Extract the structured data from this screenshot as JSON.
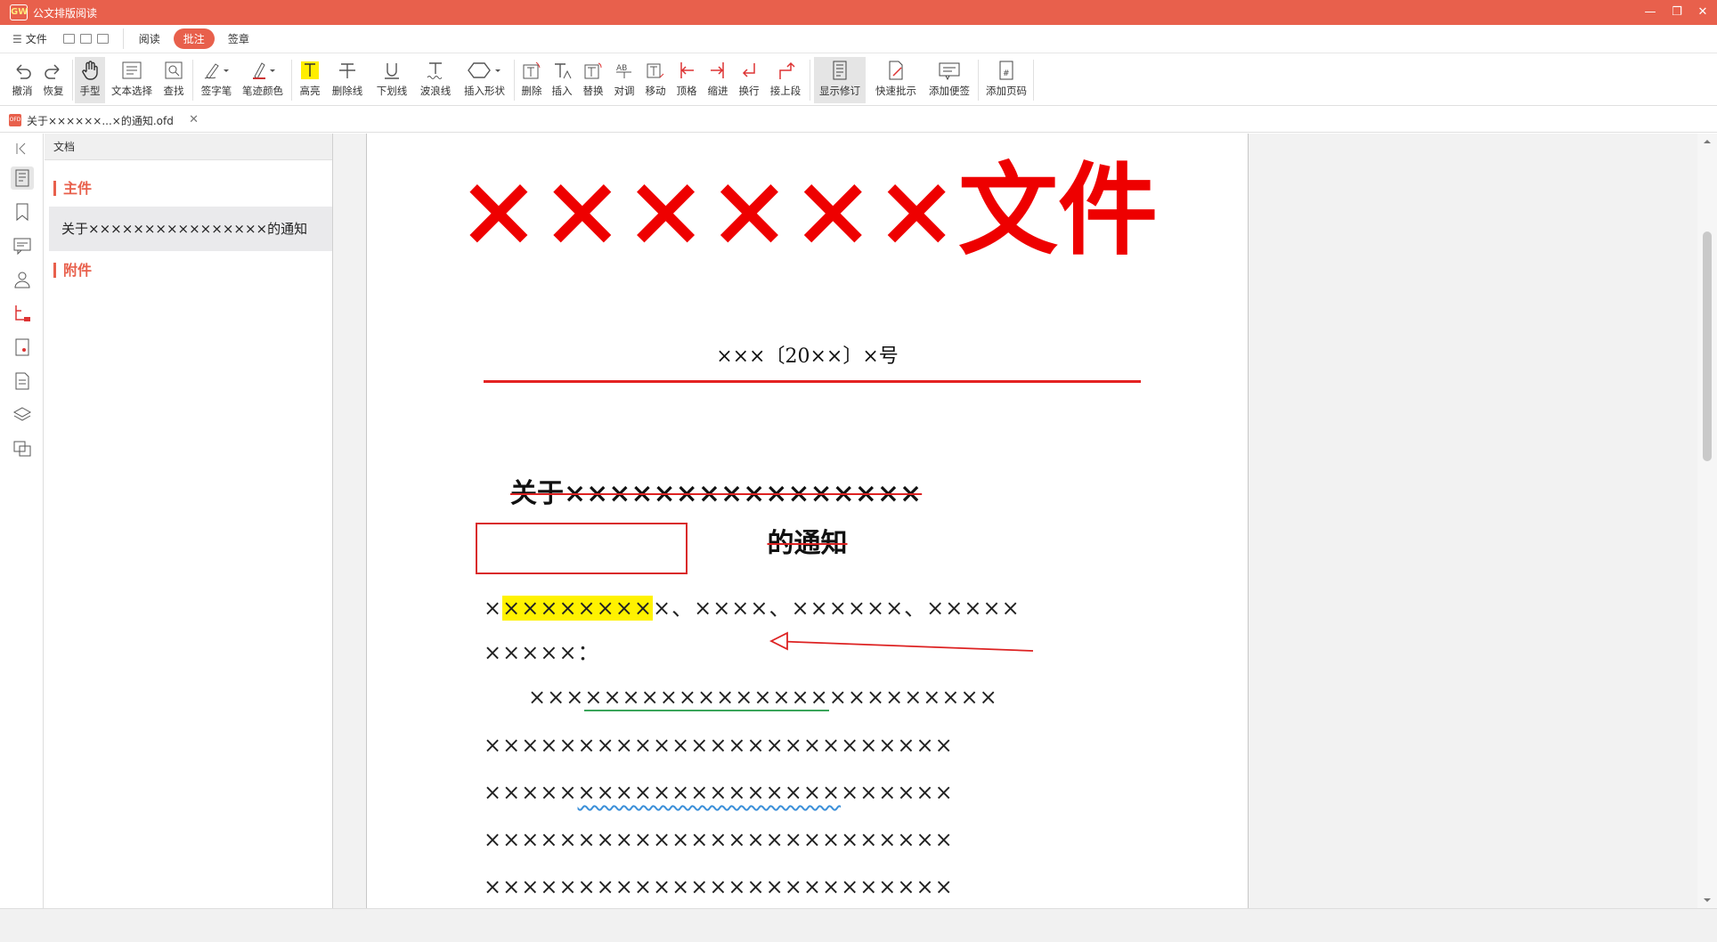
{
  "window": {
    "title": "公文排版阅读",
    "logo": "GW",
    "controls": [
      "—",
      "❐",
      "✕"
    ]
  },
  "menubar": {
    "file_label": "文件",
    "tabs": [
      {
        "label": "阅读",
        "active": false
      },
      {
        "label": "批注",
        "active": true
      },
      {
        "label": "签章",
        "active": false
      }
    ]
  },
  "toolbar": {
    "items": [
      {
        "label": "撤消",
        "icon": "undo-icon"
      },
      {
        "label": "恢复",
        "icon": "redo-icon"
      },
      {
        "label": "手型",
        "icon": "hand-icon",
        "selected": true
      },
      {
        "label": "文本选择",
        "icon": "text-select-icon"
      },
      {
        "label": "查找",
        "icon": "find-icon"
      },
      {
        "label": "签字笔",
        "icon": "pen-icon"
      },
      {
        "label": "笔迹颜色",
        "icon": "pen-color-icon"
      },
      {
        "label": "高亮",
        "icon": "highlight-icon"
      },
      {
        "label": "删除线",
        "icon": "strikethrough-icon"
      },
      {
        "label": "下划线",
        "icon": "underline-icon"
      },
      {
        "label": "波浪线",
        "icon": "wavy-line-icon"
      },
      {
        "label": "插入形状",
        "icon": "shape-icon"
      },
      {
        "label": "删除",
        "icon": "delete-mark-icon"
      },
      {
        "label": "插入",
        "icon": "insert-mark-icon"
      },
      {
        "label": "替换",
        "icon": "replace-mark-icon"
      },
      {
        "label": "对调",
        "icon": "swap-mark-icon"
      },
      {
        "label": "移动",
        "icon": "move-mark-icon"
      },
      {
        "label": "顶格",
        "icon": "align-left-mark-icon"
      },
      {
        "label": "缩进",
        "icon": "indent-mark-icon"
      },
      {
        "label": "换行",
        "icon": "newline-mark-icon"
      },
      {
        "label": "接上段",
        "icon": "join-paragraph-icon"
      },
      {
        "label": "显示修订",
        "icon": "show-revisions-icon",
        "selected": true
      },
      {
        "label": "快速批示",
        "icon": "quick-comment-icon"
      },
      {
        "label": "添加便签",
        "icon": "sticky-note-icon"
      },
      {
        "label": "添加页码",
        "icon": "page-number-icon"
      }
    ]
  },
  "doc_tab": {
    "file_badge": "OFD",
    "label": "关于××××××...×的通知.ofd",
    "close": "✕"
  },
  "left_strip": {
    "icons": [
      "collapse-icon",
      "outline-icon",
      "bookmark-icon",
      "comment-icon",
      "user-icon",
      "annotation-tree-icon",
      "page-thumbnail-icon",
      "document-icon",
      "layers-icon",
      "copy-pages-icon"
    ]
  },
  "doc_panel": {
    "header": "文档",
    "main_section": "主件",
    "main_item": "关于××××××××××××××××的通知",
    "attachment_section": "附件"
  },
  "page": {
    "title": "××××××文件",
    "doc_number": "×××〔20××〕×号",
    "heading_line1": "关于××××××××××××××××",
    "heading_line2": "的通知",
    "p1_a": "×",
    "p1_b": "××××××××",
    "p1_c": "×、××××、××××××、×××××",
    "p2": "×××××：",
    "p3_a": "　　×××",
    "p3_b": "×××××××××××××",
    "p3_c": "×××××××××",
    "p4": "×××××××××××××××××××××××××",
    "p5_a": "×××××",
    "p5_b": "××××××××××××××",
    "p5_c": "××××××",
    "p6": "×××××××××××××××××××××××××",
    "p7": "×××××××××××××××××××××××××"
  },
  "colors": {
    "accent": "#e8604c",
    "red_title": "#ee0000",
    "highlight": "#fff200",
    "green_underline": "#3aa55a",
    "wavy_blue": "#3b8fd8"
  }
}
